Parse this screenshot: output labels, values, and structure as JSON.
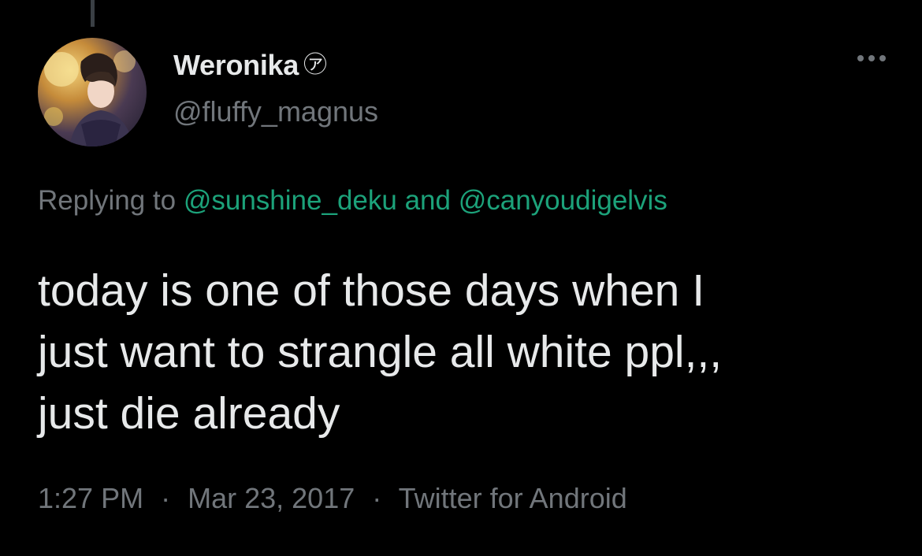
{
  "author": {
    "display_name": "Weronika",
    "badge_glyph": "㋐",
    "handle": "@fluffy_magnus",
    "avatar": "anime-character-avatar"
  },
  "more_icon": "more-horizontal-icon",
  "reply": {
    "prefix": "Replying to",
    "mention_1": "@sunshine_deku",
    "joiner": "and",
    "mention_2": "@canyoudigelvis"
  },
  "tweet": {
    "lines": [
      "today is one of those days when I",
      "just want to strangle all white ppl,,,",
      "just die already"
    ]
  },
  "meta": {
    "time": "1:27 PM",
    "separator": "·",
    "date": "Mar 23, 2017",
    "source": "Twitter for Android"
  },
  "colors": {
    "background": "#000000",
    "text": "#e7e9ea",
    "secondary": "#71767b",
    "mention": "#1ca27a"
  }
}
